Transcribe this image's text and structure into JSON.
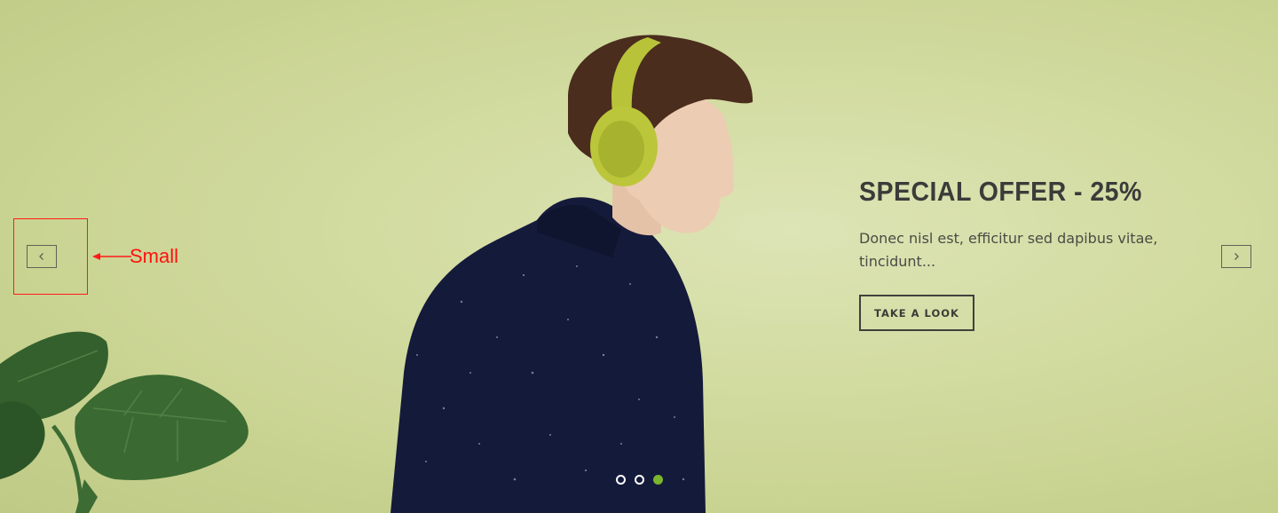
{
  "slide": {
    "title": "SPECIAL OFFER - 25%",
    "description": "Donec nisl est, efficitur sed dapibus vitae, tincidunt...",
    "button_label": "TAKE A LOOK"
  },
  "controls": {
    "prev_icon": "chevron-left-icon",
    "next_icon": "chevron-right-icon"
  },
  "pagination": {
    "count": 3,
    "active_index": 2,
    "active_color": "#7ab52f"
  },
  "annotation": {
    "label": "Small",
    "color": "#ff1010"
  },
  "colors": {
    "background": "#d3dca2",
    "text_dark": "#3b3b3a"
  }
}
